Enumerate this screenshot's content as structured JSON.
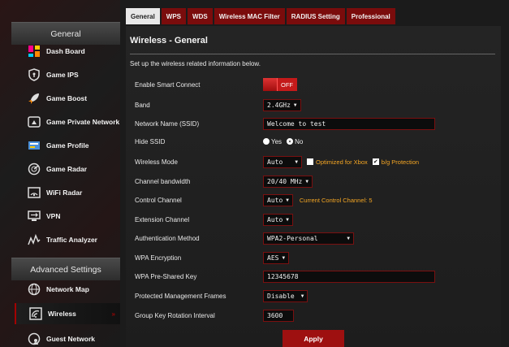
{
  "sidebar": {
    "general_header": "General",
    "advanced_header": "Advanced Settings",
    "items": [
      {
        "label": "Dash Board"
      },
      {
        "label": "Game IPS"
      },
      {
        "label": "Game Boost"
      },
      {
        "label": "Game Private Network"
      },
      {
        "label": "Game Profile"
      },
      {
        "label": "Game Radar"
      },
      {
        "label": "WiFi Radar"
      },
      {
        "label": "VPN"
      },
      {
        "label": "Traffic Analyzer"
      }
    ],
    "advanced_items": [
      {
        "label": "Network Map"
      },
      {
        "label": "Wireless",
        "active": true
      },
      {
        "label": "Guest Network"
      }
    ]
  },
  "tabs": [
    "General",
    "WPS",
    "WDS",
    "Wireless MAC Filter",
    "RADIUS Setting",
    "Professional"
  ],
  "main": {
    "title": "Wireless - General",
    "description": "Set up the wireless related information below.",
    "fields": {
      "smart_connect": {
        "label": "Enable Smart Connect",
        "value": "OFF"
      },
      "band": {
        "label": "Band",
        "value": "2.4GHz"
      },
      "ssid": {
        "label": "Network Name (SSID)",
        "value": "Welcome to test"
      },
      "hide_ssid": {
        "label": "Hide SSID",
        "yes": "Yes",
        "no": "No",
        "selected": "No"
      },
      "wireless_mode": {
        "label": "Wireless Mode",
        "value": "Auto",
        "xbox_label": "Optimized for Xbox",
        "xbox_checked": false,
        "bg_label": "b/g Protection",
        "bg_checked": true
      },
      "channel_bandwidth": {
        "label": "Channel bandwidth",
        "value": "20/40 MHz"
      },
      "control_channel": {
        "label": "Control Channel",
        "value": "Auto",
        "current": "Current Control Channel: 5"
      },
      "extension_channel": {
        "label": "Extension Channel",
        "value": "Auto"
      },
      "auth_method": {
        "label": "Authentication Method",
        "value": "WPA2-Personal"
      },
      "wpa_encryption": {
        "label": "WPA Encryption",
        "value": "AES"
      },
      "wpa_psk": {
        "label": "WPA Pre-Shared Key",
        "value": "12345678"
      },
      "pmf": {
        "label": "Protected Management Frames",
        "value": "Disable"
      },
      "group_key": {
        "label": "Group Key Rotation Interval",
        "value": "3600"
      }
    },
    "apply_label": "Apply"
  },
  "colors": {
    "accent": "#9e1010",
    "highlight": "#f5a623",
    "background": "#1b1b1b"
  }
}
